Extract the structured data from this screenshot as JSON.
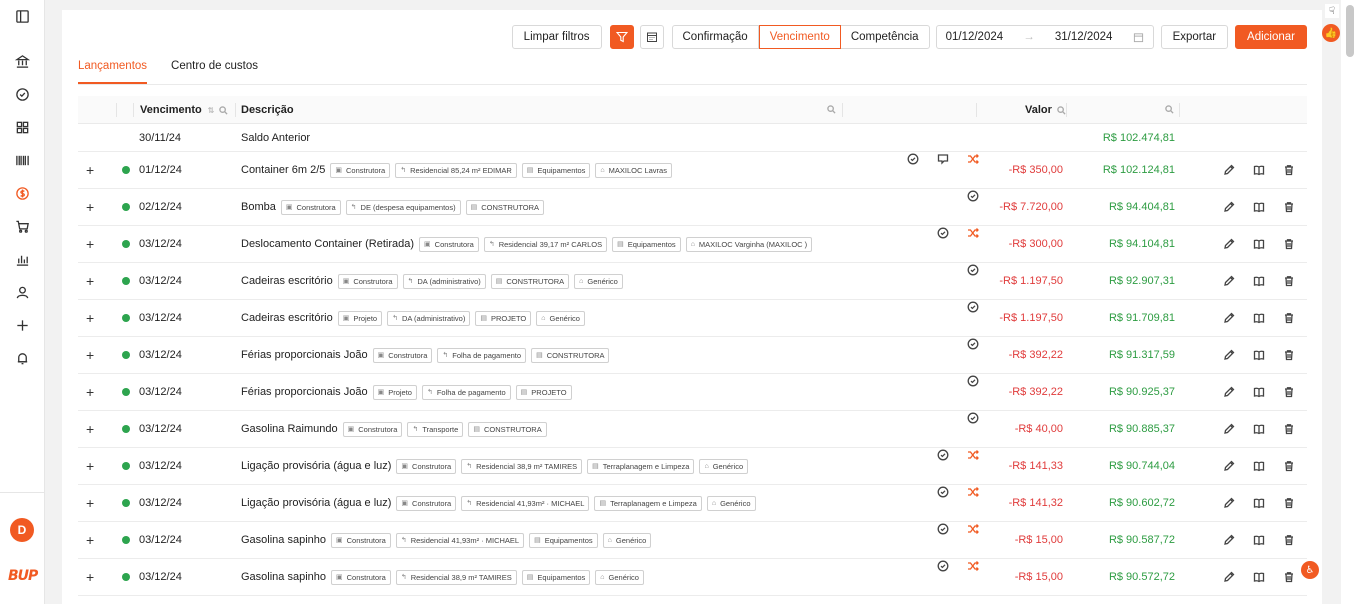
{
  "toolbar": {
    "clear_filters": "Limpar filtros",
    "modes": [
      "Confirmação",
      "Vencimento",
      "Competência"
    ],
    "active_mode": "Vencimento",
    "date_from": "01/12/2024",
    "date_to": "31/12/2024",
    "export": "Exportar",
    "add": "Adicionar"
  },
  "tabs": [
    "Lançamentos",
    "Centro de custos"
  ],
  "columns": {
    "vencimento": "Vencimento",
    "descricao": "Descrição",
    "valor": "Valor"
  },
  "opening": {
    "date": "30/11/24",
    "label": "Saldo Anterior",
    "balance": "R$ 102.474,81"
  },
  "user_initial": "D",
  "logo_text": "BUP",
  "colors": {
    "accent": "#f15a22",
    "positive": "#2d9c42",
    "negative": "#e03b3b"
  },
  "rows": [
    {
      "date": "01/12/24",
      "desc": "Container 6m 2/5",
      "tags": [
        "Construtora",
        "Residencial 85,24 m² EDIMAR",
        "Equipamentos",
        "MAXILOC Lavras"
      ],
      "icons": [
        "check-circle-icon",
        "comment-icon",
        "shuffle-icon"
      ],
      "valor": "-R$ 350,00",
      "saldo": "R$ 102.124,81"
    },
    {
      "date": "02/12/24",
      "desc": "Bomba",
      "tags": [
        "Construtora",
        "DE (despesa equipamentos)",
        "CONSTRUTORA"
      ],
      "icons": [
        "check-circle-icon"
      ],
      "valor": "-R$ 7.720,00",
      "saldo": "R$ 94.404,81"
    },
    {
      "date": "03/12/24",
      "desc": "Deslocamento Container (Retirada)",
      "tags": [
        "Construtora",
        "Residencial 39,17 m² CARLOS",
        "Equipamentos",
        "MAXILOC Varginha (MAXILOC )"
      ],
      "icons": [
        "check-circle-icon",
        "shuffle-icon"
      ],
      "valor": "-R$ 300,00",
      "saldo": "R$ 94.104,81"
    },
    {
      "date": "03/12/24",
      "desc": "Cadeiras escritório",
      "tags": [
        "Construtora",
        "DA (administrativo)",
        "CONSTRUTORA",
        "Genérico"
      ],
      "icons": [
        "check-circle-icon"
      ],
      "valor": "-R$ 1.197,50",
      "saldo": "R$ 92.907,31"
    },
    {
      "date": "03/12/24",
      "desc": "Cadeiras escritório",
      "tags": [
        "Projeto",
        "DA (administrativo)",
        "PROJETO",
        "Genérico"
      ],
      "icons": [
        "check-circle-icon"
      ],
      "valor": "-R$ 1.197,50",
      "saldo": "R$ 91.709,81"
    },
    {
      "date": "03/12/24",
      "desc": "Férias proporcionais João",
      "tags": [
        "Construtora",
        "Folha de pagamento",
        "CONSTRUTORA"
      ],
      "icons": [
        "check-circle-icon"
      ],
      "valor": "-R$ 392,22",
      "saldo": "R$ 91.317,59"
    },
    {
      "date": "03/12/24",
      "desc": "Férias proporcionais João",
      "tags": [
        "Projeto",
        "Folha de pagamento",
        "PROJETO"
      ],
      "icons": [
        "check-circle-icon"
      ],
      "valor": "-R$ 392,22",
      "saldo": "R$ 90.925,37"
    },
    {
      "date": "03/12/24",
      "desc": "Gasolina Raimundo",
      "tags": [
        "Construtora",
        "Transporte",
        "CONSTRUTORA"
      ],
      "icons": [
        "check-circle-icon"
      ],
      "valor": "-R$ 40,00",
      "saldo": "R$ 90.885,37"
    },
    {
      "date": "03/12/24",
      "desc": "Ligação provisória (água e luz)",
      "tags": [
        "Construtora",
        "Residencial 38,9 m² TAMIRES",
        "Terraplanagem e Limpeza",
        "Genérico"
      ],
      "icons": [
        "check-circle-icon",
        "shuffle-icon"
      ],
      "valor": "-R$ 141,33",
      "saldo": "R$ 90.744,04"
    },
    {
      "date": "03/12/24",
      "desc": "Ligação provisória (água e luz)",
      "tags": [
        "Construtora",
        "Residencial 41,93m² · MICHAEL",
        "Terraplanagem e Limpeza",
        "Genérico"
      ],
      "icons": [
        "check-circle-icon",
        "shuffle-icon"
      ],
      "valor": "-R$ 141,32",
      "saldo": "R$ 90.602,72"
    },
    {
      "date": "03/12/24",
      "desc": "Gasolina sapinho",
      "tags": [
        "Construtora",
        "Residencial 41,93m² · MICHAEL",
        "Equipamentos",
        "Genérico"
      ],
      "icons": [
        "check-circle-icon",
        "shuffle-icon"
      ],
      "valor": "-R$ 15,00",
      "saldo": "R$ 90.587,72"
    },
    {
      "date": "03/12/24",
      "desc": "Gasolina sapinho",
      "tags": [
        "Construtora",
        "Residencial 38,9 m² TAMIRES",
        "Equipamentos",
        "Genérico"
      ],
      "icons": [
        "check-circle-icon",
        "shuffle-icon"
      ],
      "valor": "-R$ 15,00",
      "saldo": "R$ 90.572,72"
    }
  ]
}
